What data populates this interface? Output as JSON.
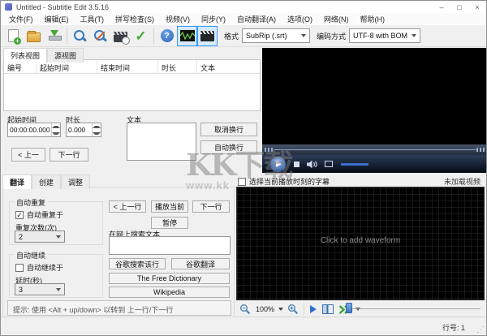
{
  "window": {
    "title": "Untitled - Subtitle Edit 3.5.16",
    "minimize": "–",
    "maximize": "□",
    "close": "×"
  },
  "menu": {
    "items": [
      "文件(F)",
      "编辑(E)",
      "工具(T)",
      "拼写检查(S)",
      "视频(V)",
      "同步(Y)",
      "自动翻译(A)",
      "选项(O)",
      "网络(N)",
      "帮助(H)"
    ]
  },
  "toolbar": {
    "format_label": "格式",
    "format_value": "SubRip (.srt)",
    "encoding_label": "编码方式",
    "encoding_value": "UTF-8 with BOM"
  },
  "icons": {
    "plus_glyph": "+",
    "spellcheck_glyph": "✓",
    "help_glyph": "?"
  },
  "subtitle_list": {
    "tab_list_view": "列表视图",
    "tab_source_view": "源视图",
    "columns": [
      "编号",
      "起始时间",
      "结束时间",
      "时长",
      "文本"
    ]
  },
  "editor": {
    "start_time_label": "起始时间",
    "start_time_value": "00:00:00.000",
    "duration_label": "时长",
    "duration_value": "0.000",
    "text_label": "文本",
    "unbreak_button": "取消换行",
    "auto_break_button": "自动换行",
    "prev_button": "< 上一",
    "next_button": "下一行"
  },
  "translate_panel": {
    "tab_translate": "翻译",
    "tab_create": "创建",
    "tab_adjust": "调整",
    "auto_repeat_group": "自动重复",
    "auto_repeat_checkbox": "自动重复于",
    "auto_repeat_check_glyph": "✓",
    "repeat_count_label": "重复次数(次)",
    "repeat_count_value": "2",
    "auto_continue_group": "自动继续",
    "auto_continue_checkbox": "自动继续于",
    "auto_continue_check_glyph": "",
    "delay_label": "延时(秒)",
    "delay_value": "3",
    "prev_line_button": "< 上一行",
    "play_current_button": "播放当前",
    "next_line_button": "下一行",
    "pause_button": "暂停",
    "web_search_label": "在网上搜索文本",
    "google_search_button": "谷歌搜索该行",
    "google_translate_button": "谷歌翻译",
    "free_dictionary_button": "The Free Dictionary",
    "wikipedia_button": "Wikipedia",
    "hint": "提示: 使用 <Alt + up/down> 以转到 上一行/下一行"
  },
  "waveform_panel": {
    "select_current_label": "选择当前播放时刻的字幕",
    "select_current_check_glyph": "",
    "no_video_label": "未加载视频",
    "placeholder": "Click to add waveform",
    "zoom_value": "100%"
  },
  "status_bar": {
    "line_number": "行号: 1"
  },
  "watermark": {
    "title": "KK下载",
    "url": "www.kk"
  },
  "colors": {
    "toggle_accent": "#3399ff",
    "waveform_green": "#6fd34f",
    "player_play_blue": "#3a74cc",
    "volume_bar_blue": "#3f6fd0"
  }
}
